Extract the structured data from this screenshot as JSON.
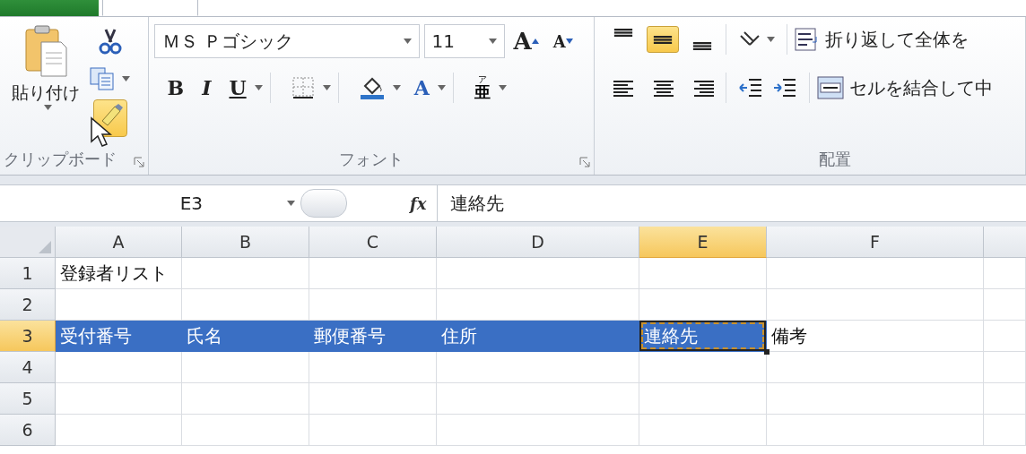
{
  "ribbon": {
    "clipboard": {
      "label": "クリップボード",
      "paste_label": "貼り付け",
      "tools": [
        {
          "kind": "cut",
          "hovered": false
        },
        {
          "kind": "copy",
          "hovered": false
        },
        {
          "kind": "painter",
          "hovered": true
        }
      ]
    },
    "font": {
      "label": "フォント",
      "font_name": "ＭＳ Ｐゴシック",
      "font_size": "11",
      "top_buttons": [
        {
          "kind": "grow",
          "label": "A"
        },
        {
          "kind": "shrink",
          "label": "A"
        }
      ],
      "bottom_buttons": [
        {
          "kind": "bold",
          "label": "B"
        },
        {
          "kind": "italic",
          "label": "I"
        },
        {
          "kind": "underline",
          "label": "U"
        },
        {
          "kind": "borders"
        },
        {
          "kind": "fill"
        },
        {
          "kind": "font_color",
          "label": "A"
        },
        {
          "kind": "phonetic",
          "label_top": "ア",
          "label": "亜"
        }
      ]
    },
    "alignment": {
      "label": "配置",
      "vertical": [
        {
          "kind": "top",
          "selected": false
        },
        {
          "kind": "middle",
          "selected": true
        },
        {
          "kind": "bottom",
          "selected": false
        }
      ],
      "horizontal": [
        {
          "kind": "left",
          "selected": false
        },
        {
          "kind": "center",
          "selected": false
        },
        {
          "kind": "right",
          "selected": false
        }
      ],
      "wrap_text": "折り返して全体を",
      "merge": "セルを結合して中"
    }
  },
  "formula_bar": {
    "name_box": "E3",
    "function_label": "fx",
    "value": "連絡先"
  },
  "columns": [
    {
      "label": "A",
      "selected": false
    },
    {
      "label": "B",
      "selected": false
    },
    {
      "label": "C",
      "selected": false
    },
    {
      "label": "D",
      "selected": false
    },
    {
      "label": "E",
      "selected": true
    },
    {
      "label": "F",
      "selected": false
    }
  ],
  "rows": [
    {
      "label": "1",
      "selected": false,
      "cells": [
        {
          "text": "登録者リスト",
          "selected": false,
          "active": false
        }
      ]
    },
    {
      "label": "2",
      "selected": false
    },
    {
      "label": "3",
      "selected": true,
      "cells": [
        {
          "text": "受付番号",
          "selected": true,
          "active": false
        },
        {
          "text": "氏名",
          "selected": true,
          "active": false
        },
        {
          "text": "郵便番号",
          "selected": true,
          "active": false
        },
        {
          "text": "住所",
          "selected": true,
          "active": false
        },
        {
          "text": "連絡先",
          "selected": true,
          "active": true
        },
        {
          "text": "備考",
          "selected": false,
          "active": false
        }
      ]
    },
    {
      "label": "4",
      "selected": false
    },
    {
      "label": "5",
      "selected": false
    },
    {
      "label": "6",
      "selected": false
    }
  ]
}
